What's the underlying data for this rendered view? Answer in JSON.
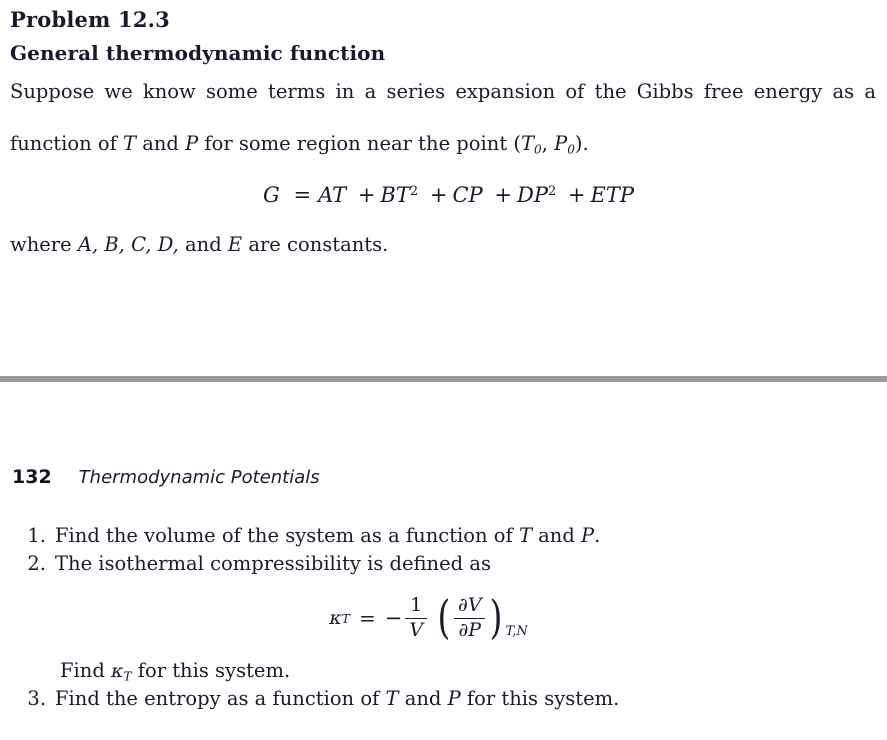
{
  "document": {
    "background_color": "#ffffff",
    "text_color": "#1a1a2e"
  },
  "problem": {
    "title": "Problem 12.3",
    "subtitle": "General thermodynamic function",
    "paragraph_line1": "Suppose we know some terms in a series expansion of the Gibbs free energy as a",
    "paragraph_line2_prefix": "function of ",
    "paragraph_var_T": "T",
    "paragraph_line2_mid": " and ",
    "paragraph_var_P": "P",
    "paragraph_line2_suffix": " for some region near the point (",
    "point_T": "T",
    "point_T_sub": "0",
    "point_comma": ", ",
    "point_P": "P",
    "point_P_sub": "0",
    "point_close": ").",
    "equation": {
      "lhs": "G",
      "equals": "=",
      "term1_coef": "A",
      "term1_var": "T",
      "plus1": "+",
      "term2_coef": "B",
      "term2_var": "T",
      "term2_exp": "2",
      "plus2": "+",
      "term3_coef": "C",
      "term3_var": "P",
      "plus3": "+",
      "term4_coef": "D",
      "term4_var": "P",
      "term4_exp": "2",
      "plus4": "+",
      "term5": "ETP"
    },
    "where_prefix": "where ",
    "where_constants": "A, B, C, D,",
    "where_and": " and ",
    "where_last": "E",
    "where_suffix": " are constants."
  },
  "divider": {
    "color": "#9a9a9a"
  },
  "page_header": {
    "page_number": "132",
    "running_title": "Thermodynamic Potentials"
  },
  "questions": [
    {
      "number": "1.",
      "text_prefix": "Find the volume of the system as a function of ",
      "var_a": "T",
      "text_mid": " and ",
      "var_b": "P",
      "text_suffix": "."
    },
    {
      "number": "2.",
      "text_prefix": "The isothermal compressibility is defined as",
      "var_a": "",
      "text_mid": "",
      "var_b": "",
      "text_suffix": ""
    },
    {
      "number": "3.",
      "text_prefix": "Find the entropy as a function of ",
      "var_a": "T",
      "text_mid": " and ",
      "var_b": "P",
      "text_suffix": " for this system."
    }
  ],
  "kappa_equation": {
    "kappa": "κ",
    "kappa_sub": "T",
    "equals": "=",
    "minus": "−",
    "frac_numerator": "1",
    "frac_denominator": "V",
    "paren_open": "(",
    "paren_close": ")",
    "partial_numerator_d": "∂",
    "partial_numerator_var": "V",
    "partial_denominator_d": "∂",
    "partial_denominator_var": "P",
    "subscript": "T,N"
  },
  "find_kappa_line": {
    "prefix": "Find ",
    "kappa": "κ",
    "kappa_sub": "T",
    "suffix": " for this system."
  }
}
